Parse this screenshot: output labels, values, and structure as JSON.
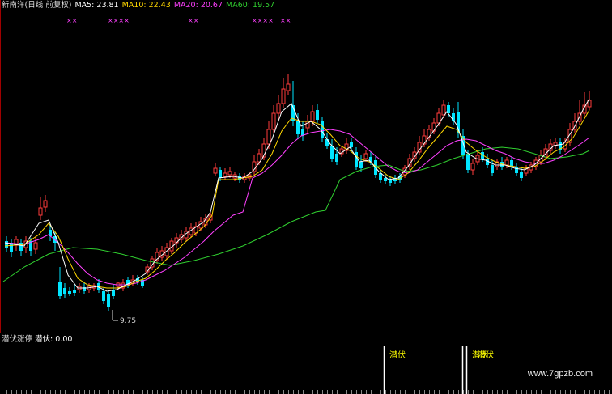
{
  "legend": {
    "title": "新南洋(日线 前复权)",
    "ma5": "MA5: 23.81",
    "ma10": "MA10: 22.43",
    "ma20": "MA20: 20.67",
    "ma60": "MA60: 19.57"
  },
  "colors": {
    "up": "#ff3c3c",
    "down": "#00e5ff",
    "ma5": "#ffffff",
    "ma10": "#ffd700",
    "ma20": "#ff40ff",
    "ma60": "#30d030",
    "marker": "#ff40ff",
    "signal": "#ffff00"
  },
  "markers": [
    "××",
    "××××",
    "××",
    "××××",
    "××"
  ],
  "low_label": "9.75",
  "indicator": {
    "name": "潜伏涨停",
    "value_label": "潜伏: 0.00",
    "signal_label": "潜伏"
  },
  "watermark": "www.7gpzb.com"
}
